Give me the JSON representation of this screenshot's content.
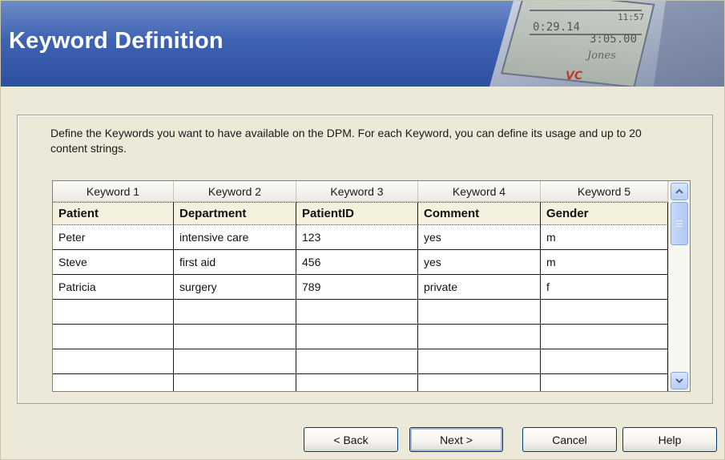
{
  "header": {
    "title": "Keyword Definition",
    "graphic": {
      "time_line1": "0:29.14",
      "time_line2": "11:57",
      "time_line3": "3:05.00",
      "name": "Jones",
      "brand": "VC"
    }
  },
  "instructions": "Define the Keywords you want to have available on the DPM. For each Keyword, you can define its usage and up to 20 content strings.",
  "grid": {
    "columns": [
      "Keyword 1",
      "Keyword 2",
      "Keyword 3",
      "Keyword 4",
      "Keyword 5"
    ],
    "keyword_names": [
      "Patient",
      "Department",
      "PatientID",
      "Comment",
      "Gender"
    ],
    "rows": [
      [
        "Peter",
        "intensive care",
        "123",
        "yes",
        "m"
      ],
      [
        "Steve",
        "first aid",
        "456",
        "yes",
        "m"
      ],
      [
        "Patricia",
        "surgery",
        "789",
        "private",
        "f"
      ],
      [
        "",
        "",
        "",
        "",
        ""
      ],
      [
        "",
        "",
        "",
        "",
        ""
      ],
      [
        "",
        "",
        "",
        "",
        ""
      ],
      [
        "",
        "",
        "",
        "",
        ""
      ]
    ],
    "scrollbar": {
      "up_icon": "chevron-up-icon",
      "down_icon": "chevron-down-icon"
    }
  },
  "buttons": {
    "back": "< Back",
    "next": "Next >",
    "cancel": "Cancel",
    "help": "Help"
  },
  "colors": {
    "banner": "#3f63b3",
    "dialog_bg": "#ece9d8",
    "header_row_bg": "#f4f0de",
    "scroll_accent": "#b6cdf5"
  }
}
